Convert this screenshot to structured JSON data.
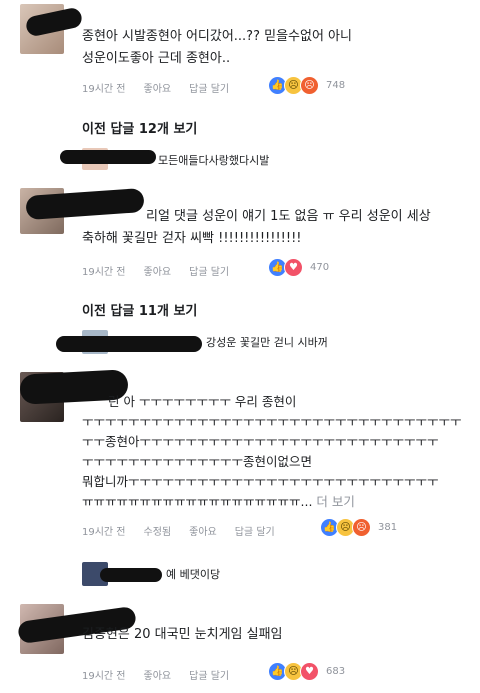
{
  "threads": {
    "c1": {
      "lines": [
        "종현아 시발종현아 어디갔어...?? 믿을수없어 아니",
        "성운이도좋아 근데 종현아.."
      ],
      "time": "19시간 전",
      "like": "좋아요",
      "reply": "답글 달기",
      "reactions": [
        "like-icon",
        "sad-icon",
        "angry-icon"
      ],
      "count": "748"
    },
    "prev1": "이전 답글 12개 보기",
    "r1": {
      "text": "모든애들다사랑했다시발"
    },
    "c2": {
      "lines": [
        "리얼 댓글 성운이 얘기 1도 없음 ㅠ 우리 성운이 세상",
        "축하해 꽃길만 걷자 씨빡 !!!!!!!!!!!!!!!!"
      ],
      "time": "19시간 전",
      "like": "좋아요",
      "reply": "답글 달기",
      "reactions": [
        "like-icon",
        "love-icon"
      ],
      "count": "470"
    },
    "prev2": "이전 답글 11개 보기",
    "r2": {
      "text": "강성운 꽃길만 걷니 시바꺼"
    },
    "c3": {
      "lines": [
        "린 아 ㅜㅜㅜㅜㅜㅜㅜㅜ 우리 종현이",
        "ㅜㅜㅜㅜㅜㅜㅜㅜㅜㅜㅜㅜㅜㅜㅜㅜㅜㅜㅜㅜㅜㅜㅜㅜㅜㅜㅜㅜㅜㅜㅜㅜㅜ",
        "ㅜㅜ종현아ㅜㅜㅜㅜㅜㅜㅜㅜㅜㅜㅜㅜㅜㅜㅜㅜㅜㅜㅜㅜㅜㅜㅜㅜㅜㅜ",
        "ㅜㅜㅜㅜㅜㅜㅜㅜㅜㅜㅜㅜㅜㅜ종현이없으면",
        "뭐합니까ㅜㅜㅜㅜㅜㅜㅜㅜㅜㅜㅜㅜㅜㅜㅜㅜㅜㅜㅜㅜㅜㅜㅜㅜㅜㅜㅜ",
        "ㅠㅠㅠㅠㅠㅠㅠㅠㅠㅠㅠㅠㅠㅠㅠㅠㅠㅠㅠ..."
      ],
      "more": "더 보기",
      "time": "19시간 전",
      "edited": "수정됨",
      "like": "좋아요",
      "reply": "답글 달기",
      "reactions": [
        "like-icon",
        "sad-icon",
        "angry-icon"
      ],
      "count": "381"
    },
    "r3": {
      "text": "예 베댓이당"
    },
    "c4": {
      "lines": [
        "김종현은 20 대국민 눈치게임 실패임"
      ],
      "time": "19시간 전",
      "like": "좋아요",
      "reply": "답글 달기",
      "reactions": [
        "like-icon",
        "sad-icon",
        "love-icon"
      ],
      "count": "683"
    }
  },
  "colors": {
    "like": "#4080ff",
    "love": "#f25268",
    "sad": "#f7c33f",
    "angry": "#f06030",
    "meta": "#90949c"
  }
}
